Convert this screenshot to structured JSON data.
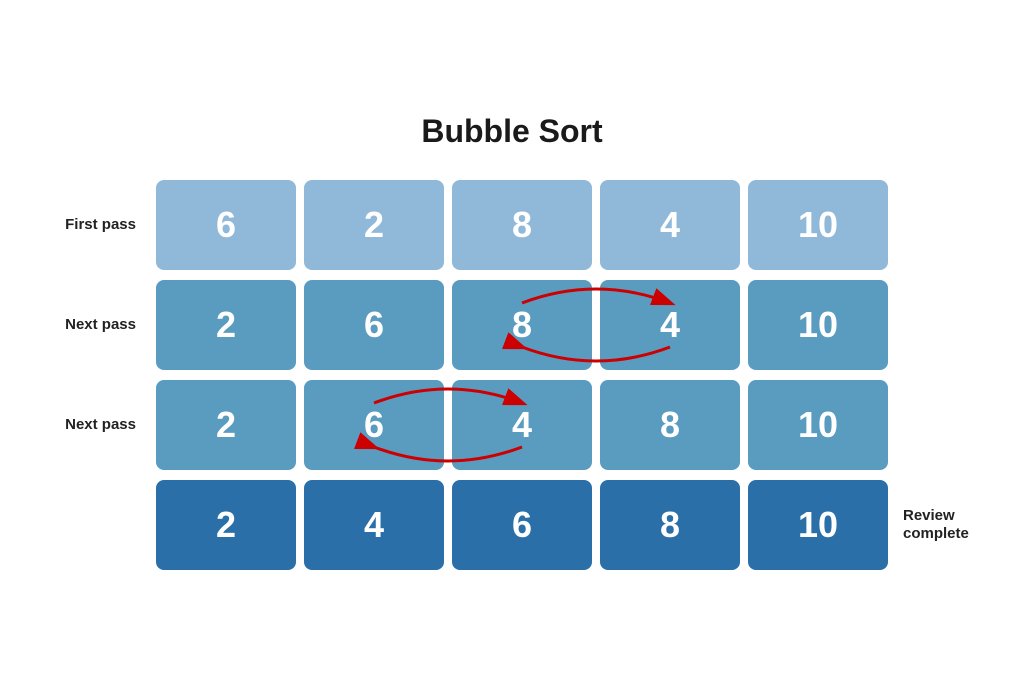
{
  "title": "Bubble Sort",
  "rows": [
    {
      "label": "First pass",
      "label_id": "first-pass",
      "cells": [
        6,
        2,
        8,
        4,
        10
      ],
      "style": "light",
      "arrow": null,
      "suffix": null
    },
    {
      "label": "Next pass",
      "label_id": "next-pass-1",
      "cells": [
        2,
        6,
        8,
        4,
        10
      ],
      "style": "mid",
      "arrow": {
        "from": 2,
        "to": 3
      },
      "suffix": null
    },
    {
      "label": "Next pass",
      "label_id": "next-pass-2",
      "cells": [
        2,
        6,
        4,
        8,
        10
      ],
      "style": "mid",
      "arrow": {
        "from": 1,
        "to": 2
      },
      "suffix": null
    },
    {
      "label": null,
      "label_id": "final",
      "cells": [
        2,
        4,
        6,
        8,
        10
      ],
      "style": "dark",
      "arrow": null,
      "suffix": "Review complete"
    }
  ]
}
